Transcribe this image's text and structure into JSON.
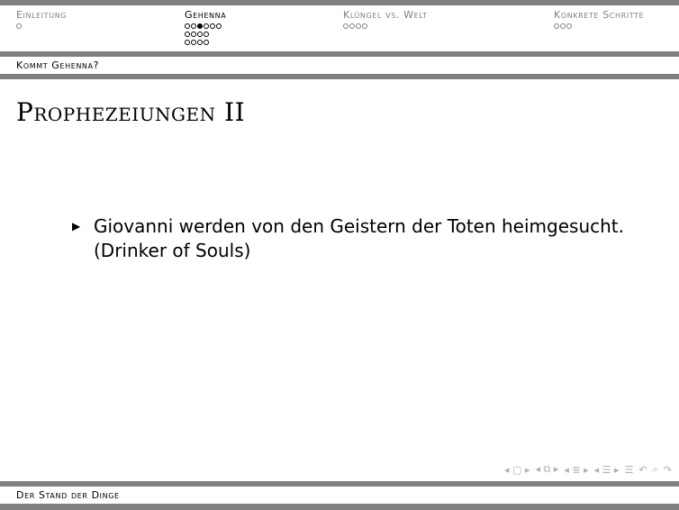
{
  "header": {
    "sections": [
      {
        "title": "Einleitung",
        "active": false,
        "rows": [
          [
            0
          ]
        ]
      },
      {
        "title": "Gehenna",
        "active": true,
        "rows": [
          [
            0,
            0,
            1,
            0,
            0,
            0
          ],
          [
            0,
            0,
            0,
            0
          ],
          [
            0,
            0,
            0,
            0
          ]
        ]
      },
      {
        "title": "Klüngel vs. Welt",
        "active": false,
        "rows": [
          [
            0,
            0,
            0,
            0
          ]
        ]
      },
      {
        "title": "Konkrete Schritte",
        "active": false,
        "rows": [
          [
            0,
            0,
            0
          ]
        ]
      }
    ]
  },
  "subsection": "Kommt Gehenna?",
  "frame": {
    "title": "Prophezeiungen II",
    "bullets": [
      {
        "text": "Giovanni werden von den Geistern der Toten heimgesucht. (Drinker of Souls)"
      }
    ]
  },
  "footer": {
    "title": "Der Stand der Dinge"
  },
  "colors": {
    "bar": "#808080",
    "inactive_text": "#808080",
    "nav_symbols": "#b0b0b0"
  }
}
